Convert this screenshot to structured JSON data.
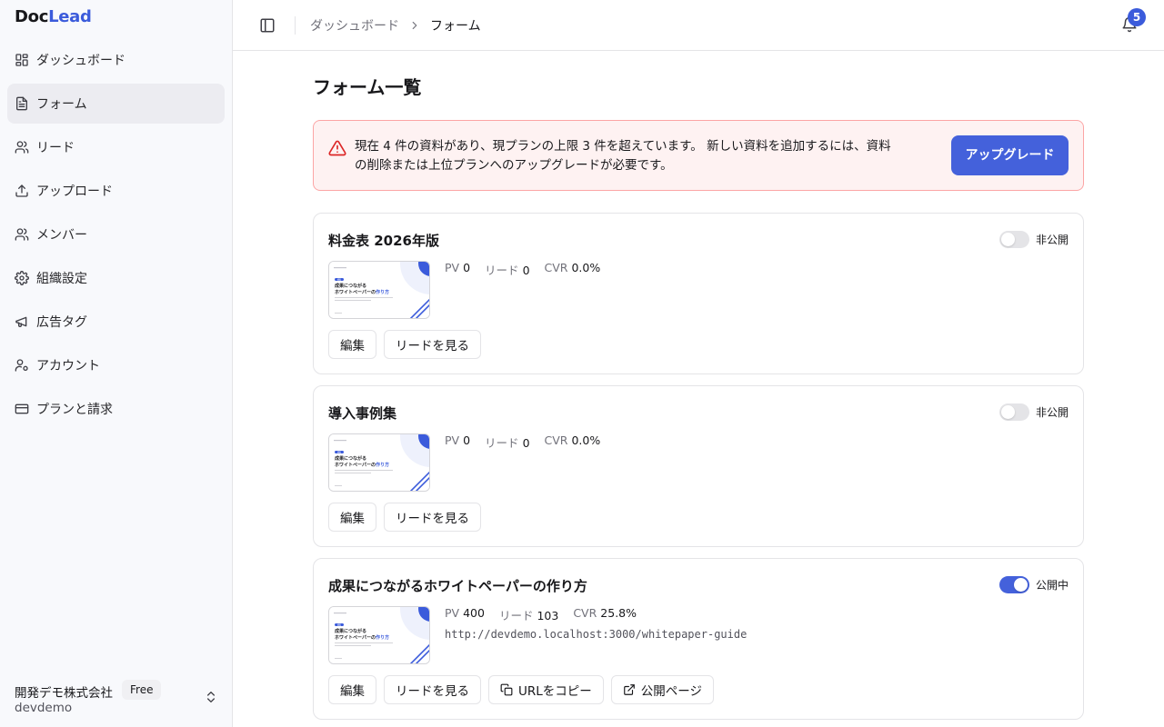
{
  "app": {
    "logo_part1": "Doc",
    "logo_part2": "Lead",
    "brand_color": "#3b5bdb"
  },
  "sidebar": {
    "items": [
      {
        "label": "ダッシュボード",
        "icon": "dashboard-icon",
        "active": false
      },
      {
        "label": "フォーム",
        "icon": "file-text-icon",
        "active": true
      },
      {
        "label": "リード",
        "icon": "users-icon",
        "active": false
      },
      {
        "label": "アップロード",
        "icon": "upload-icon",
        "active": false
      },
      {
        "label": "メンバー",
        "icon": "members-icon",
        "active": false
      },
      {
        "label": "組織設定",
        "icon": "gear-icon",
        "active": false
      },
      {
        "label": "広告タグ",
        "icon": "megaphone-icon",
        "active": false
      },
      {
        "label": "アカウント",
        "icon": "user-cog-icon",
        "active": false
      },
      {
        "label": "プランと請求",
        "icon": "credit-card-icon",
        "active": false
      }
    ],
    "org": {
      "name": "開発デモ株式会社",
      "plan": "Free",
      "slug": "devdemo"
    }
  },
  "header": {
    "breadcrumb": [
      "ダッシュボード",
      "フォーム"
    ],
    "notification_count": "5"
  },
  "main": {
    "title": "フォーム一覧",
    "alert": {
      "message": "現在 4 件の資料があり、現プランの上限 3 件を超えています。 新しい資料を追加するには、資料の削除または上位プランへのアップグレードが必要です。",
      "button": "アップグレード",
      "color": "#dc2626"
    },
    "stat_labels": {
      "pv": "PV",
      "leads": "リード",
      "cvr": "CVR"
    },
    "buttons": {
      "edit": "編集",
      "view_leads": "リードを見る",
      "copy_url": "URLをコピー",
      "public_page": "公開ページ"
    },
    "thumbnail": {
      "badge": "資料",
      "line1": "成果につながる",
      "line2a": "ホワイトペーパー",
      "line2b": "の",
      "line2c": "作り方"
    },
    "forms": [
      {
        "title": "料金表 2026年版",
        "status": "非公開",
        "published": false,
        "pv": "0",
        "leads": "0",
        "cvr": "0.0%",
        "url": ""
      },
      {
        "title": "導入事例集",
        "status": "非公開",
        "published": false,
        "pv": "0",
        "leads": "0",
        "cvr": "0.0%",
        "url": ""
      },
      {
        "title": "成果につながるホワイトペーパーの作り方",
        "status": "公開中",
        "published": true,
        "pv": "400",
        "leads": "103",
        "cvr": "25.8%",
        "url": "http://devdemo.localhost:3000/whitepaper-guide"
      }
    ]
  }
}
